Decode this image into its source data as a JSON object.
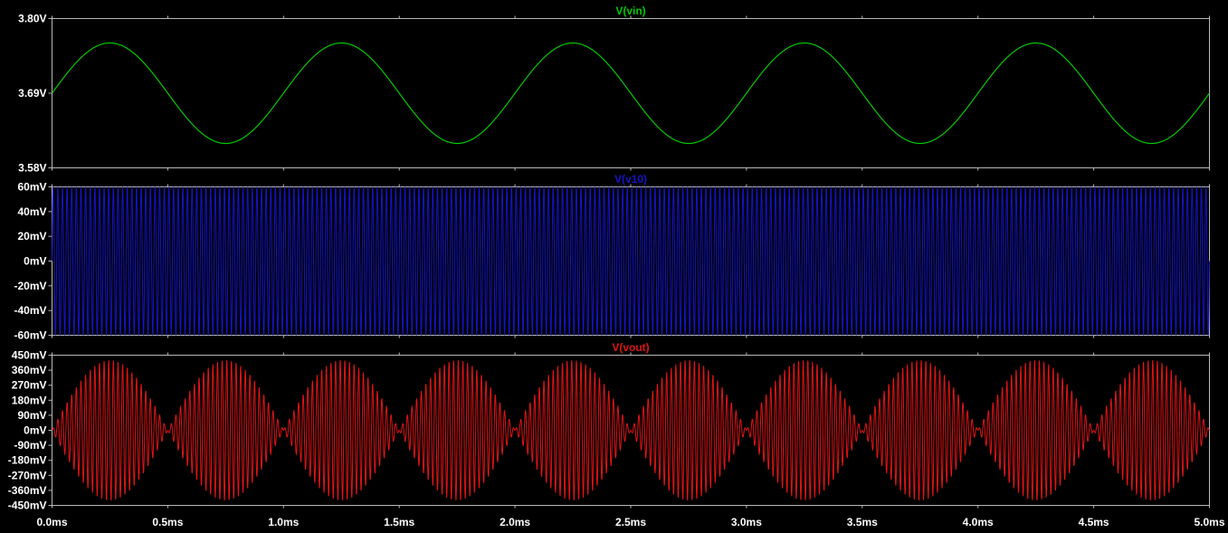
{
  "chart_data": [
    {
      "type": "line",
      "series": [
        {
          "name": "V(vin)",
          "color": "#00c800",
          "waveform": "sine",
          "offset": 3.69,
          "amplitude": 0.074,
          "frequency_hz": 1000,
          "x_start_ms": 0,
          "x_end_ms": 5
        }
      ],
      "title": "V(vin)",
      "xlabel": "",
      "ylabel": "",
      "ylim": [
        3.58,
        3.8
      ],
      "y_ticks": [
        3.58,
        3.69,
        3.8
      ],
      "y_tick_labels": [
        "3.58V",
        "3.69V",
        "3.80V"
      ],
      "xlim": [
        0,
        5
      ],
      "grid": false
    },
    {
      "type": "line",
      "series": [
        {
          "name": "V(v10)",
          "color": "#1414c8",
          "waveform": "sine",
          "offset": 0,
          "amplitude": 0.06,
          "frequency_hz": 50000,
          "x_start_ms": 0,
          "x_end_ms": 5
        }
      ],
      "title": "V(v10)",
      "xlabel": "",
      "ylabel": "",
      "ylim": [
        -0.06,
        0.06
      ],
      "y_ticks": [
        -0.06,
        -0.04,
        -0.02,
        0,
        0.02,
        0.04,
        0.06
      ],
      "y_tick_labels": [
        "-60mV",
        "-40mV",
        "-20mV",
        "0mV",
        "20mV",
        "40mV",
        "60mV"
      ],
      "xlim": [
        0,
        5
      ],
      "grid": false
    },
    {
      "type": "line",
      "series": [
        {
          "name": "V(vout)",
          "color": "#e01414",
          "waveform": "amplitude-modulated (DSB)",
          "carrier_frequency_hz": 50000,
          "envelope_frequency_hz": 2000,
          "peak_amplitude": 0.42,
          "x_start_ms": 0,
          "x_end_ms": 5
        }
      ],
      "title": "V(vout)",
      "xlabel": "",
      "ylabel": "",
      "ylim": [
        -0.45,
        0.45
      ],
      "y_ticks": [
        -0.45,
        -0.36,
        -0.27,
        -0.18,
        -0.09,
        0,
        0.09,
        0.18,
        0.27,
        0.36,
        0.45
      ],
      "y_tick_labels": [
        "-450mV",
        "-360mV",
        "-270mV",
        "-180mV",
        "-90mV",
        "0mV",
        "90mV",
        "180mV",
        "270mV",
        "360mV",
        "450mV"
      ],
      "xlim": [
        0,
        5
      ],
      "grid": false
    }
  ],
  "x_axis": {
    "ticks": [
      0,
      0.5,
      1.0,
      1.5,
      2.0,
      2.5,
      3.0,
      3.5,
      4.0,
      4.5,
      5.0
    ],
    "tick_labels": [
      "0.0ms",
      "0.5ms",
      "1.0ms",
      "1.5ms",
      "2.0ms",
      "2.5ms",
      "3.0ms",
      "3.5ms",
      "4.0ms",
      "4.5ms",
      "5.0ms"
    ]
  },
  "colors": {
    "background": "#000000",
    "frame": "#b8b8b8",
    "tick_text": "#ffffff"
  }
}
